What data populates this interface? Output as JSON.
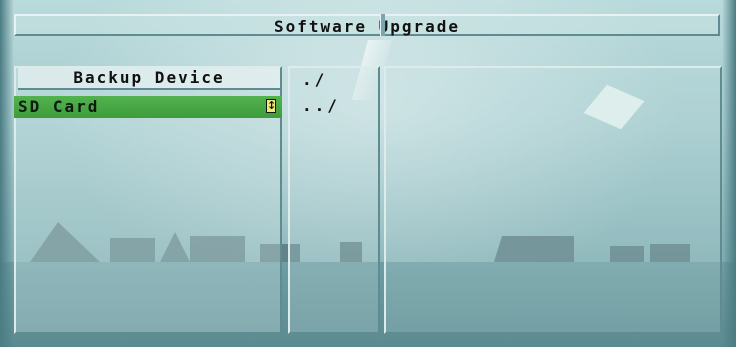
{
  "window": {
    "title": "Software Upgrade"
  },
  "device_panel": {
    "header": "Backup Device",
    "items": [
      {
        "label": "SD Card",
        "selected": true
      }
    ]
  },
  "file_panel": {
    "entries": [
      "./",
      "../"
    ]
  },
  "colors": {
    "selection": "#4aab46",
    "overlay": "#c8e1e2"
  }
}
